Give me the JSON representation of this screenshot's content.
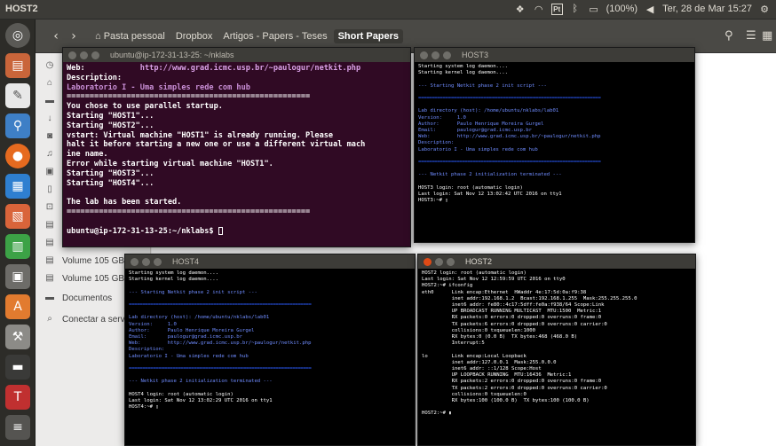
{
  "top_panel": {
    "title": "HOST2",
    "battery": "(100%)",
    "clock": "Ter, 28 de Mar 15:27",
    "indicator_box": "Pt"
  },
  "file_manager": {
    "breadcrumbs": [
      {
        "label": "Pasta pessoal"
      },
      {
        "label": "Dropbox"
      },
      {
        "label": "Artigos - Papers - Teses"
      },
      {
        "label": "Short Papers"
      }
    ],
    "sidebar": {
      "volume1": "Volume 105 GB",
      "volume2": "Volume 105 GB",
      "documents": "Documentos",
      "connect": "Conectar a servidor"
    }
  },
  "terminal_main": {
    "title": "ubuntu@ip-172-31-13-25: ~/nklabs",
    "web_label": "Web:",
    "web_url": "http://www.grad.icmc.usp.br/~paulogur/netkit.php",
    "desc_label": "Description:",
    "desc_value": "Laboratorio I - Uma simples rede com hub",
    "separator": "=====================================================",
    "lines": [
      "You chose to use parallel startup.",
      "Starting \"HOST1\"...",
      "Starting \"HOST2\"...",
      "vstart: Virtual machine \"HOST1\" is already running. Please",
      "halt it before starting a new one or use a different virtual mach",
      "ine name.",
      "Error while starting virtual machine \"HOST1\".",
      "Starting \"HOST3\"...",
      "Starting \"HOST4\"..."
    ],
    "started": "The lab has been started.",
    "prompt": "ubuntu@ip-172-31-13-25:~/nklabs$ "
  },
  "terminal_host3": {
    "title": "HOST3",
    "lines": [
      {
        "t": "Starting system log daemon....",
        "c": ""
      },
      {
        "t": "Starting kernel log daemon....",
        "c": ""
      },
      {
        "t": "",
        "c": ""
      },
      {
        "t": "--- Starting Netkit phase 2 init script ---",
        "c": "blue"
      },
      {
        "t": "",
        "c": ""
      },
      {
        "t": "===================================================================",
        "c": "bar"
      },
      {
        "t": "",
        "c": ""
      },
      {
        "t": "Lab directory (host): /home/ubuntu/nklabs/lab01",
        "c": "blue"
      },
      {
        "t": "Version:     1.0",
        "c": "blue"
      },
      {
        "t": "Author:      Paulo Henrique Moreira Gurgel",
        "c": "blue"
      },
      {
        "t": "Email:       paulogur@grad.icmc.usp.br",
        "c": "blue"
      },
      {
        "t": "Web:         http://www.grad.icmc.usp.br/~paulogur/netkit.php",
        "c": "blue"
      },
      {
        "t": "Description:",
        "c": "blue"
      },
      {
        "t": "Laboratorio I - Uma simples rede com hub",
        "c": "blue"
      },
      {
        "t": "",
        "c": ""
      },
      {
        "t": "===================================================================",
        "c": "bar"
      },
      {
        "t": "",
        "c": ""
      },
      {
        "t": "--- Netkit phase 2 initialization terminated ---",
        "c": "blue"
      },
      {
        "t": "",
        "c": ""
      },
      {
        "t": "HOST3 login: root (automatic login)",
        "c": ""
      },
      {
        "t": "Last login: Sat Nov 12 13:02:42 UTC 2016 on tty1",
        "c": ""
      },
      {
        "t": "HOST3:~# ▯",
        "c": ""
      }
    ]
  },
  "terminal_host4": {
    "title": "HOST4",
    "lines": [
      {
        "t": "Starting system log daemon....",
        "c": ""
      },
      {
        "t": "Starting kernel log daemon....",
        "c": ""
      },
      {
        "t": "",
        "c": ""
      },
      {
        "t": "--- Starting Netkit phase 2 init script ---",
        "c": "blue"
      },
      {
        "t": "",
        "c": ""
      },
      {
        "t": "===================================================================",
        "c": "bar"
      },
      {
        "t": "",
        "c": ""
      },
      {
        "t": "Lab directory (host): /home/ubuntu/nklabs/lab01",
        "c": "blue"
      },
      {
        "t": "Version:     1.0",
        "c": "blue"
      },
      {
        "t": "Author:      Paulo Henrique Moreira Gurgel",
        "c": "blue"
      },
      {
        "t": "Email:       paulogur@grad.icmc.usp.br",
        "c": "blue"
      },
      {
        "t": "Web:         http://www.grad.icmc.usp.br/~paulogur/netkit.php",
        "c": "blue"
      },
      {
        "t": "Description:",
        "c": "blue"
      },
      {
        "t": "Laboratorio I - Uma simples rede com hub",
        "c": "blue"
      },
      {
        "t": "",
        "c": ""
      },
      {
        "t": "===================================================================",
        "c": "bar"
      },
      {
        "t": "",
        "c": ""
      },
      {
        "t": "--- Netkit phase 2 initialization terminated ---",
        "c": "blue"
      },
      {
        "t": "",
        "c": ""
      },
      {
        "t": "HOST4 login: root (automatic login)",
        "c": ""
      },
      {
        "t": "Last login: Sat Nov 12 13:02:29 UTC 2016 on tty1",
        "c": ""
      },
      {
        "t": "HOST4:~# ▯",
        "c": ""
      }
    ]
  },
  "terminal_host2": {
    "title": "HOST2",
    "lines": [
      {
        "t": "HOST2 login: root (automatic login)",
        "c": ""
      },
      {
        "t": "Last login: Sat Nov 12 12:59:59 UTC 2016 on tty0",
        "c": ""
      },
      {
        "t": "HOST2:~# ifconfig",
        "c": ""
      },
      {
        "t": "eth0      Link encap:Ethernet  HWaddr 4e:17:5d:0a:f9:38",
        "c": ""
      },
      {
        "t": "          inet addr:192.168.1.2  Bcast:192.168.1.255  Mask:255.255.255.0",
        "c": ""
      },
      {
        "t": "          inet6 addr: fe80::4c17:5dff:fe0a:f938/64 Scope:Link",
        "c": ""
      },
      {
        "t": "          UP BROADCAST RUNNING MULTICAST  MTU:1500  Metric:1",
        "c": ""
      },
      {
        "t": "          RX packets:0 errors:0 dropped:0 overruns:0 frame:0",
        "c": ""
      },
      {
        "t": "          TX packets:6 errors:0 dropped:0 overruns:0 carrier:0",
        "c": ""
      },
      {
        "t": "          collisions:0 txqueuelen:1000",
        "c": ""
      },
      {
        "t": "          RX bytes:0 (0.0 B)  TX bytes:468 (468.0 B)",
        "c": ""
      },
      {
        "t": "          Interrupt:5",
        "c": ""
      },
      {
        "t": "",
        "c": ""
      },
      {
        "t": "lo        Link encap:Local Loopback",
        "c": ""
      },
      {
        "t": "          inet addr:127.0.0.1  Mask:255.0.0.0",
        "c": ""
      },
      {
        "t": "          inet6 addr: ::1/128 Scope:Host",
        "c": ""
      },
      {
        "t": "          UP LOOPBACK RUNNING  MTU:16436  Metric:1",
        "c": ""
      },
      {
        "t": "          RX packets:2 errors:0 dropped:0 overruns:0 frame:0",
        "c": ""
      },
      {
        "t": "          TX packets:2 errors:0 dropped:0 overruns:0 carrier:0",
        "c": ""
      },
      {
        "t": "          collisions:0 txqueuelen:0",
        "c": ""
      },
      {
        "t": "          RX bytes:100 (100.0 B)  TX bytes:100 (100.0 B)",
        "c": ""
      },
      {
        "t": "",
        "c": ""
      },
      {
        "t": "HOST2:~# ▮",
        "c": ""
      }
    ]
  },
  "colors": {
    "panel": "#3c3b37",
    "terminal_purple": "#300a24",
    "close_button": "#df4a16",
    "netkit_blue": "#6f8cff"
  },
  "icons": {
    "launcher": [
      "dash-icon",
      "files-icon",
      "text-editor-icon",
      "software-icon",
      "firefox-icon",
      "writer-icon",
      "impress-icon",
      "calc-icon",
      "system-monitor-icon",
      "ubuntu-software-icon",
      "settings-icon",
      "terminal-icon",
      "fonts-icon",
      "workspaces-icon"
    ]
  }
}
